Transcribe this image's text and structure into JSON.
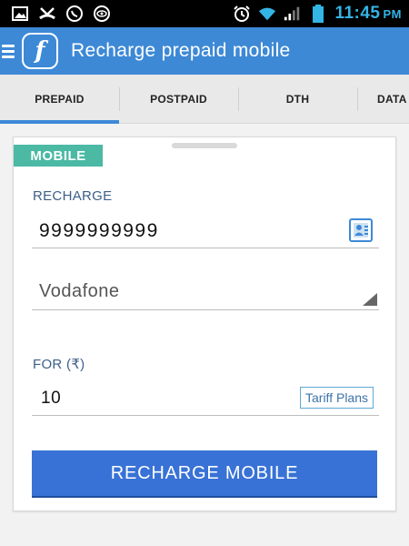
{
  "status_bar": {
    "time": "11:45",
    "ampm": "PM"
  },
  "app_bar": {
    "logo_glyph": "f",
    "title": "Recharge prepaid mobile"
  },
  "tabs": [
    {
      "label": "PREPAID",
      "active": true
    },
    {
      "label": "POSTPAID",
      "active": false
    },
    {
      "label": "DTH",
      "active": false
    },
    {
      "label": "DATA",
      "active": false
    }
  ],
  "card": {
    "badge": "MOBILE",
    "recharge_label": "RECHARGE",
    "phone_number": "9999999999",
    "operator": "Vodafone",
    "amount_label": "FOR (₹)",
    "amount": "10",
    "tariff_button": "Tariff Plans",
    "submit_button": "RECHARGE MOBILE"
  },
  "colors": {
    "app_bar": "#3d89d6",
    "badge": "#4bb9a4",
    "button": "#3872d6",
    "clock": "#33b5e5"
  }
}
